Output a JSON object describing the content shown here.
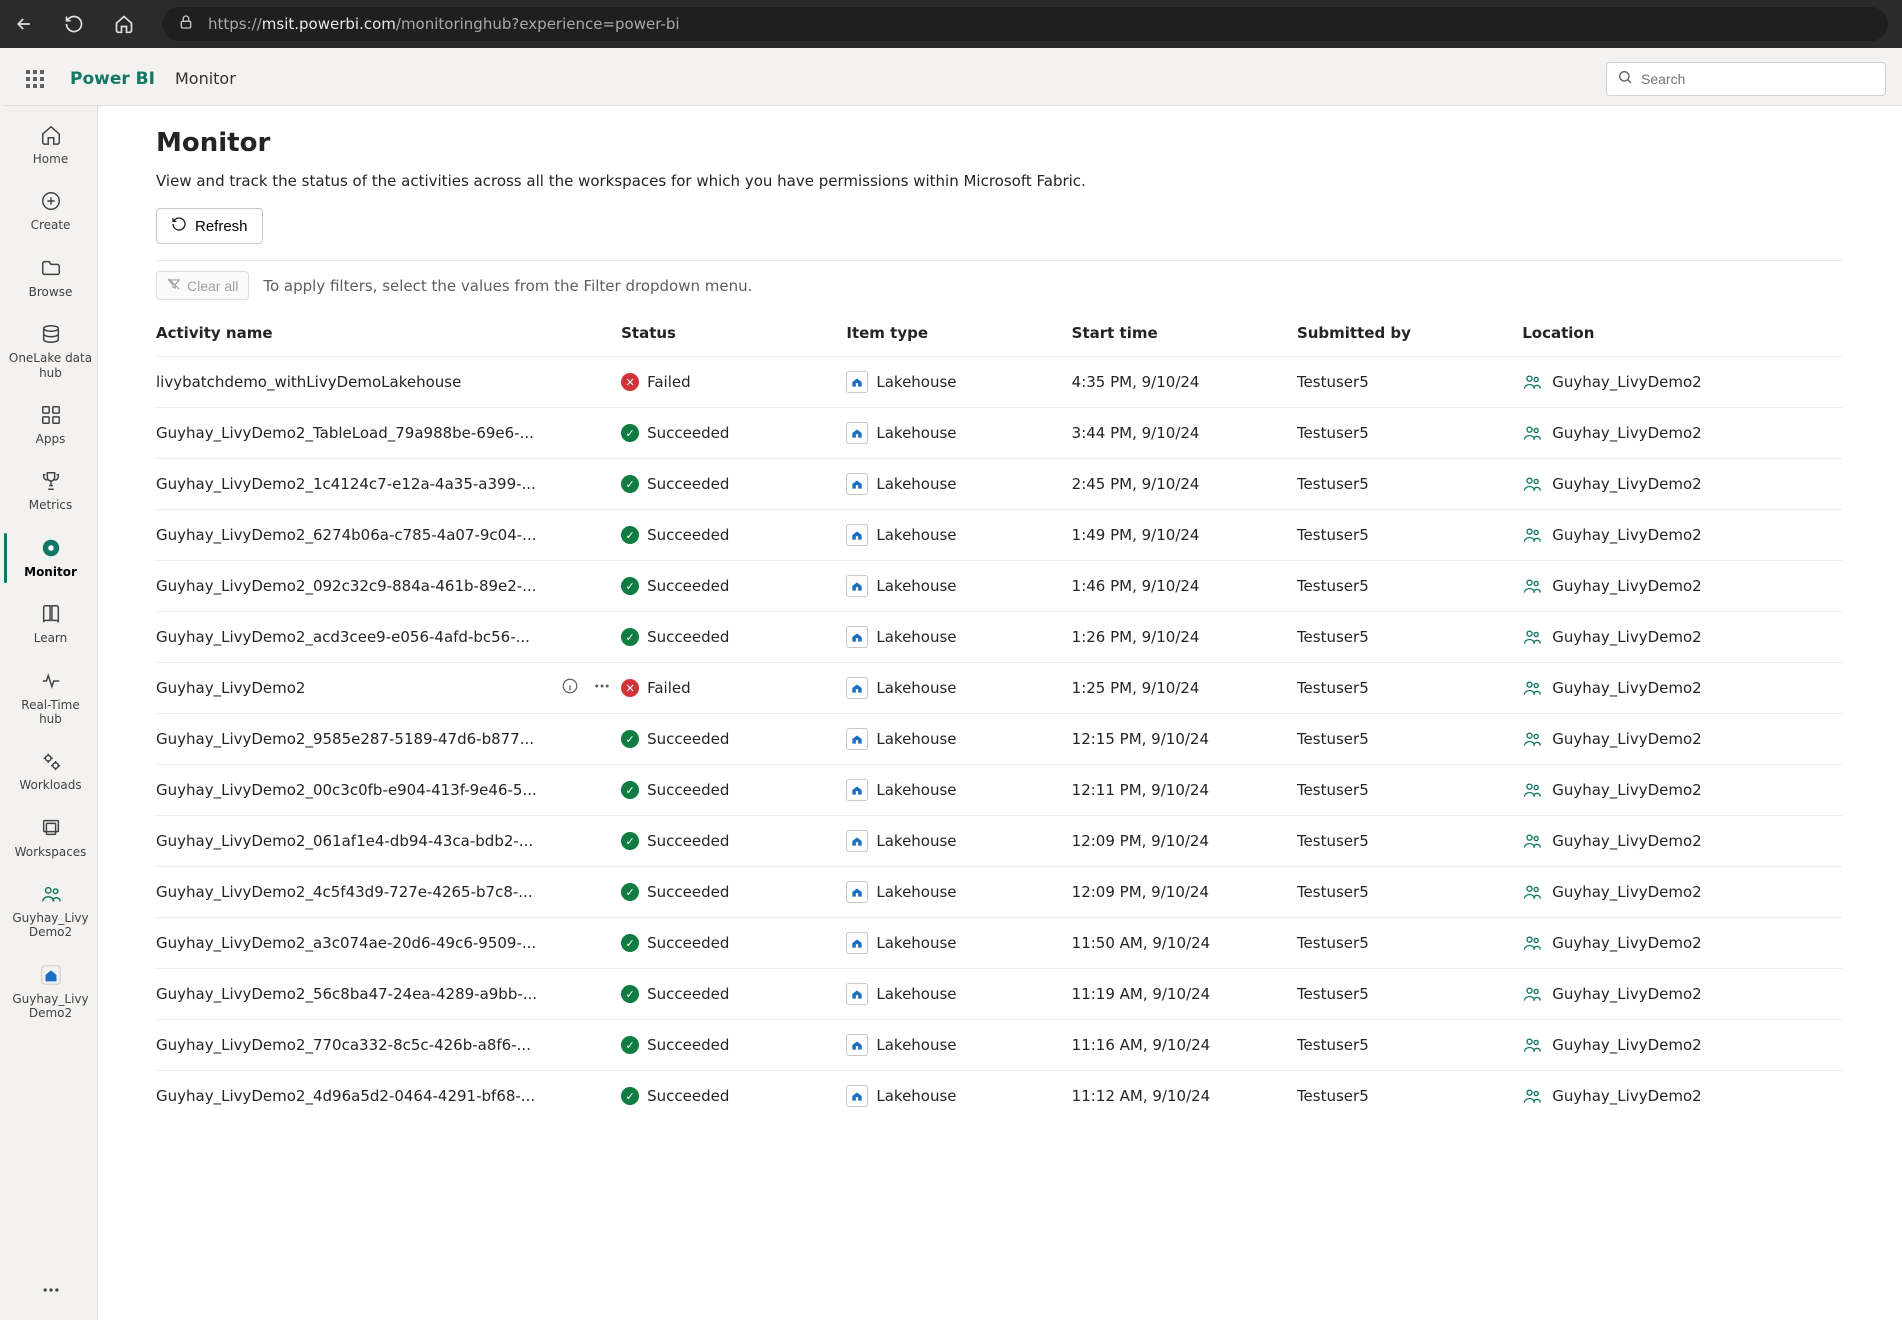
{
  "browser": {
    "url_prefix": "https://",
    "url_host": "msit.powerbi.com",
    "url_path": "/monitoringhub?experience=power-bi"
  },
  "header": {
    "brand": "Power BI",
    "crumb": "Monitor",
    "search_placeholder": "Search"
  },
  "rail": {
    "items": [
      {
        "label": "Home",
        "icon": "home"
      },
      {
        "label": "Create",
        "icon": "plus-circle"
      },
      {
        "label": "Browse",
        "icon": "folder"
      },
      {
        "label": "OneLake data hub",
        "icon": "stack"
      },
      {
        "label": "Apps",
        "icon": "apps"
      },
      {
        "label": "Metrics",
        "icon": "trophy"
      },
      {
        "label": "Monitor",
        "icon": "monitor",
        "active": true
      },
      {
        "label": "Learn",
        "icon": "book"
      },
      {
        "label": "Real-Time hub",
        "icon": "pulse"
      },
      {
        "label": "Workloads",
        "icon": "gears"
      },
      {
        "label": "Workspaces",
        "icon": "workspaces"
      },
      {
        "label": "Guyhay_Livy Demo2",
        "icon": "ws-people"
      },
      {
        "label": "Guyhay_Livy Demo2",
        "icon": "lakehouse"
      }
    ]
  },
  "page": {
    "title": "Monitor",
    "subtitle": "View and track the status of the activities across all the workspaces for which you have permissions within Microsoft Fabric.",
    "refresh_label": "Refresh",
    "clear_all_label": "Clear all",
    "filter_hint": "To apply filters, select the values from the Filter dropdown menu."
  },
  "columns": {
    "activity": "Activity name",
    "status": "Status",
    "item": "Item type",
    "start": "Start time",
    "submitted": "Submitted by",
    "location": "Location"
  },
  "item_type_label": "Lakehouse",
  "submitted_by": "Testuser5",
  "location": "Guyhay_LivyDemo2",
  "status_labels": {
    "Succeeded": "Succeeded",
    "Failed": "Failed"
  },
  "rows": [
    {
      "activity": "livybatchdemo_withLivyDemoLakehouse",
      "status": "Failed",
      "start": "4:35 PM, 9/10/24"
    },
    {
      "activity": "Guyhay_LivyDemo2_TableLoad_79a988be-69e6-...",
      "status": "Succeeded",
      "start": "3:44 PM, 9/10/24"
    },
    {
      "activity": "Guyhay_LivyDemo2_1c4124c7-e12a-4a35-a399-...",
      "status": "Succeeded",
      "start": "2:45 PM, 9/10/24"
    },
    {
      "activity": "Guyhay_LivyDemo2_6274b06a-c785-4a07-9c04-...",
      "status": "Succeeded",
      "start": "1:49 PM, 9/10/24"
    },
    {
      "activity": "Guyhay_LivyDemo2_092c32c9-884a-461b-89e2-...",
      "status": "Succeeded",
      "start": "1:46 PM, 9/10/24"
    },
    {
      "activity": "Guyhay_LivyDemo2_acd3cee9-e056-4afd-bc56-...",
      "status": "Succeeded",
      "start": "1:26 PM, 9/10/24"
    },
    {
      "activity": "Guyhay_LivyDemo2",
      "status": "Failed",
      "start": "1:25 PM, 9/10/24",
      "hover": true
    },
    {
      "activity": "Guyhay_LivyDemo2_9585e287-5189-47d6-b877...",
      "status": "Succeeded",
      "start": "12:15 PM, 9/10/24"
    },
    {
      "activity": "Guyhay_LivyDemo2_00c3c0fb-e904-413f-9e46-5...",
      "status": "Succeeded",
      "start": "12:11 PM, 9/10/24"
    },
    {
      "activity": "Guyhay_LivyDemo2_061af1e4-db94-43ca-bdb2-...",
      "status": "Succeeded",
      "start": "12:09 PM, 9/10/24"
    },
    {
      "activity": "Guyhay_LivyDemo2_4c5f43d9-727e-4265-b7c8-...",
      "status": "Succeeded",
      "start": "12:09 PM, 9/10/24"
    },
    {
      "activity": "Guyhay_LivyDemo2_a3c074ae-20d6-49c6-9509-...",
      "status": "Succeeded",
      "start": "11:50 AM, 9/10/24"
    },
    {
      "activity": "Guyhay_LivyDemo2_56c8ba47-24ea-4289-a9bb-...",
      "status": "Succeeded",
      "start": "11:19 AM, 9/10/24"
    },
    {
      "activity": "Guyhay_LivyDemo2_770ca332-8c5c-426b-a8f6-...",
      "status": "Succeeded",
      "start": "11:16 AM, 9/10/24"
    },
    {
      "activity": "Guyhay_LivyDemo2_4d96a5d2-0464-4291-bf68-...",
      "status": "Succeeded",
      "start": "11:12 AM, 9/10/24"
    }
  ]
}
